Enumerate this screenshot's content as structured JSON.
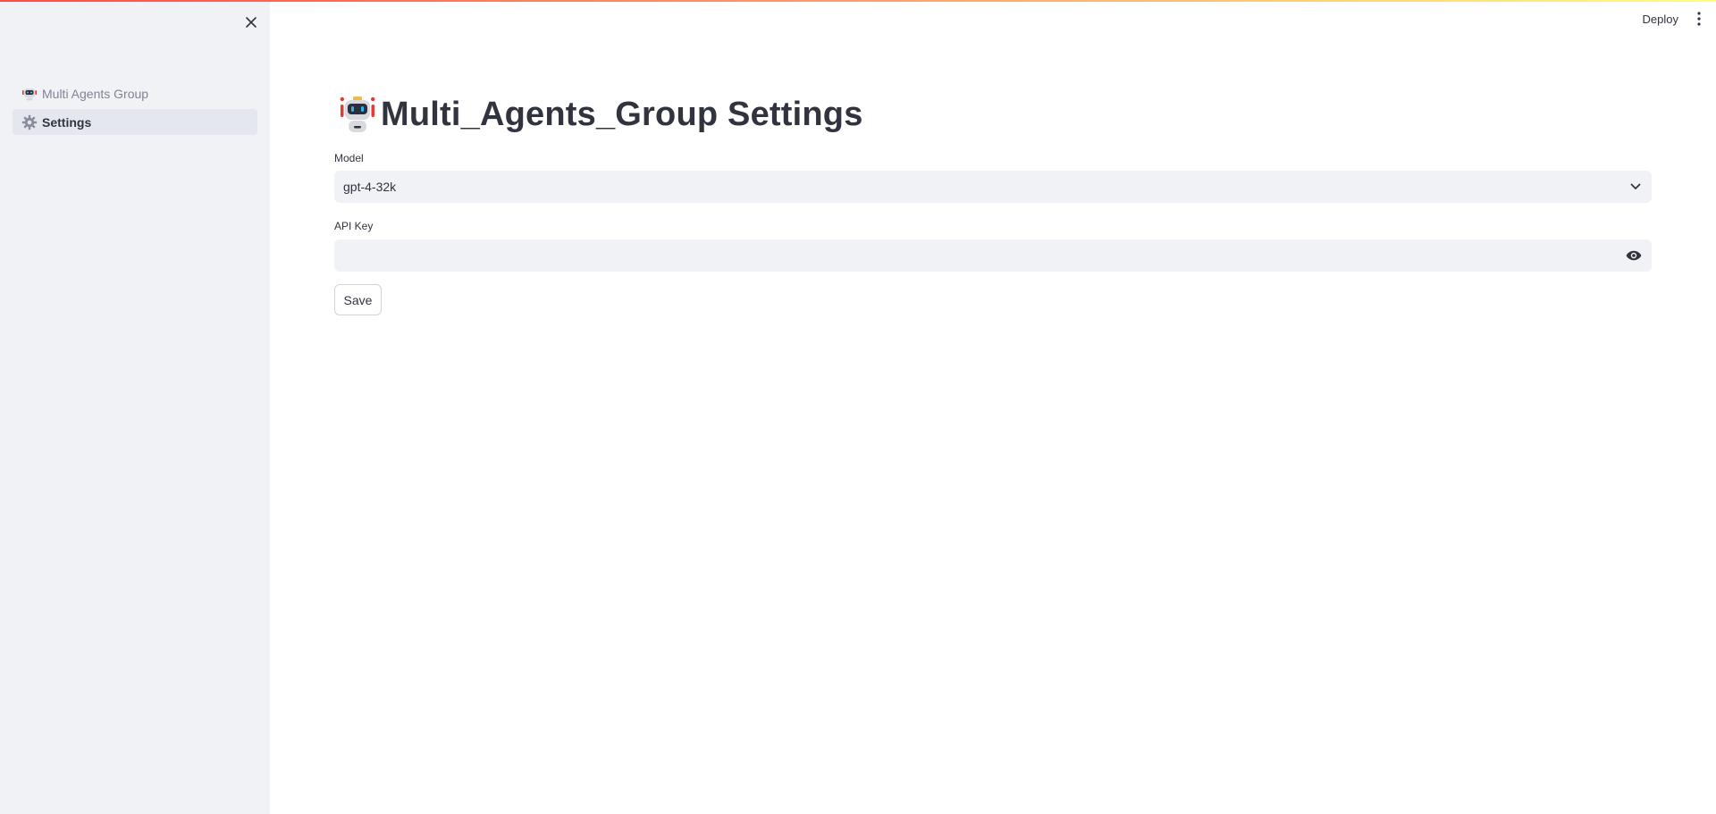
{
  "sidebar": {
    "items": [
      {
        "label": "Multi Agents Group",
        "icon": "robot-icon",
        "active": false
      },
      {
        "label": "Settings",
        "icon": "gear-icon",
        "active": true
      }
    ]
  },
  "header": {
    "deploy_label": "Deploy"
  },
  "main": {
    "title": "Multi_Agents_Group Settings",
    "model": {
      "label": "Model",
      "selected": "gpt-4-32k"
    },
    "api_key": {
      "label": "API Key",
      "value": ""
    },
    "save_label": "Save"
  },
  "colors": {
    "sidebar_bg": "#f0f2f6",
    "input_bg": "#f0f2f6",
    "text": "#31333f",
    "accent": "#ff4b4b"
  }
}
